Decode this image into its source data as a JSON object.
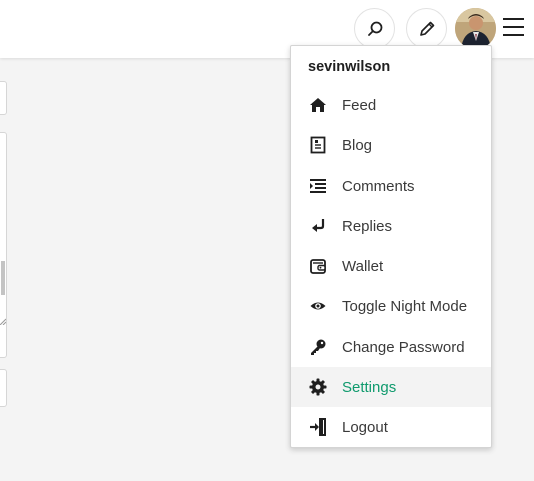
{
  "header": {
    "search_icon": "search-icon",
    "edit_icon": "pencil-icon",
    "menu_icon": "hamburger-menu-icon"
  },
  "dropdown": {
    "username": "sevinwilson",
    "items": [
      {
        "label": "Feed",
        "icon": "home-icon"
      },
      {
        "label": "Blog",
        "icon": "blog-icon"
      },
      {
        "label": "Comments",
        "icon": "comments-icon"
      },
      {
        "label": "Replies",
        "icon": "reply-icon"
      },
      {
        "label": "Wallet",
        "icon": "wallet-icon"
      },
      {
        "label": "Toggle Night Mode",
        "icon": "eye-icon"
      },
      {
        "label": "Change Password",
        "icon": "key-icon"
      },
      {
        "label": "Settings",
        "icon": "gear-icon",
        "active": true
      },
      {
        "label": "Logout",
        "icon": "logout-icon"
      }
    ]
  },
  "colors": {
    "active_label": "#0f9a6d",
    "background": "#f4f4f4"
  }
}
